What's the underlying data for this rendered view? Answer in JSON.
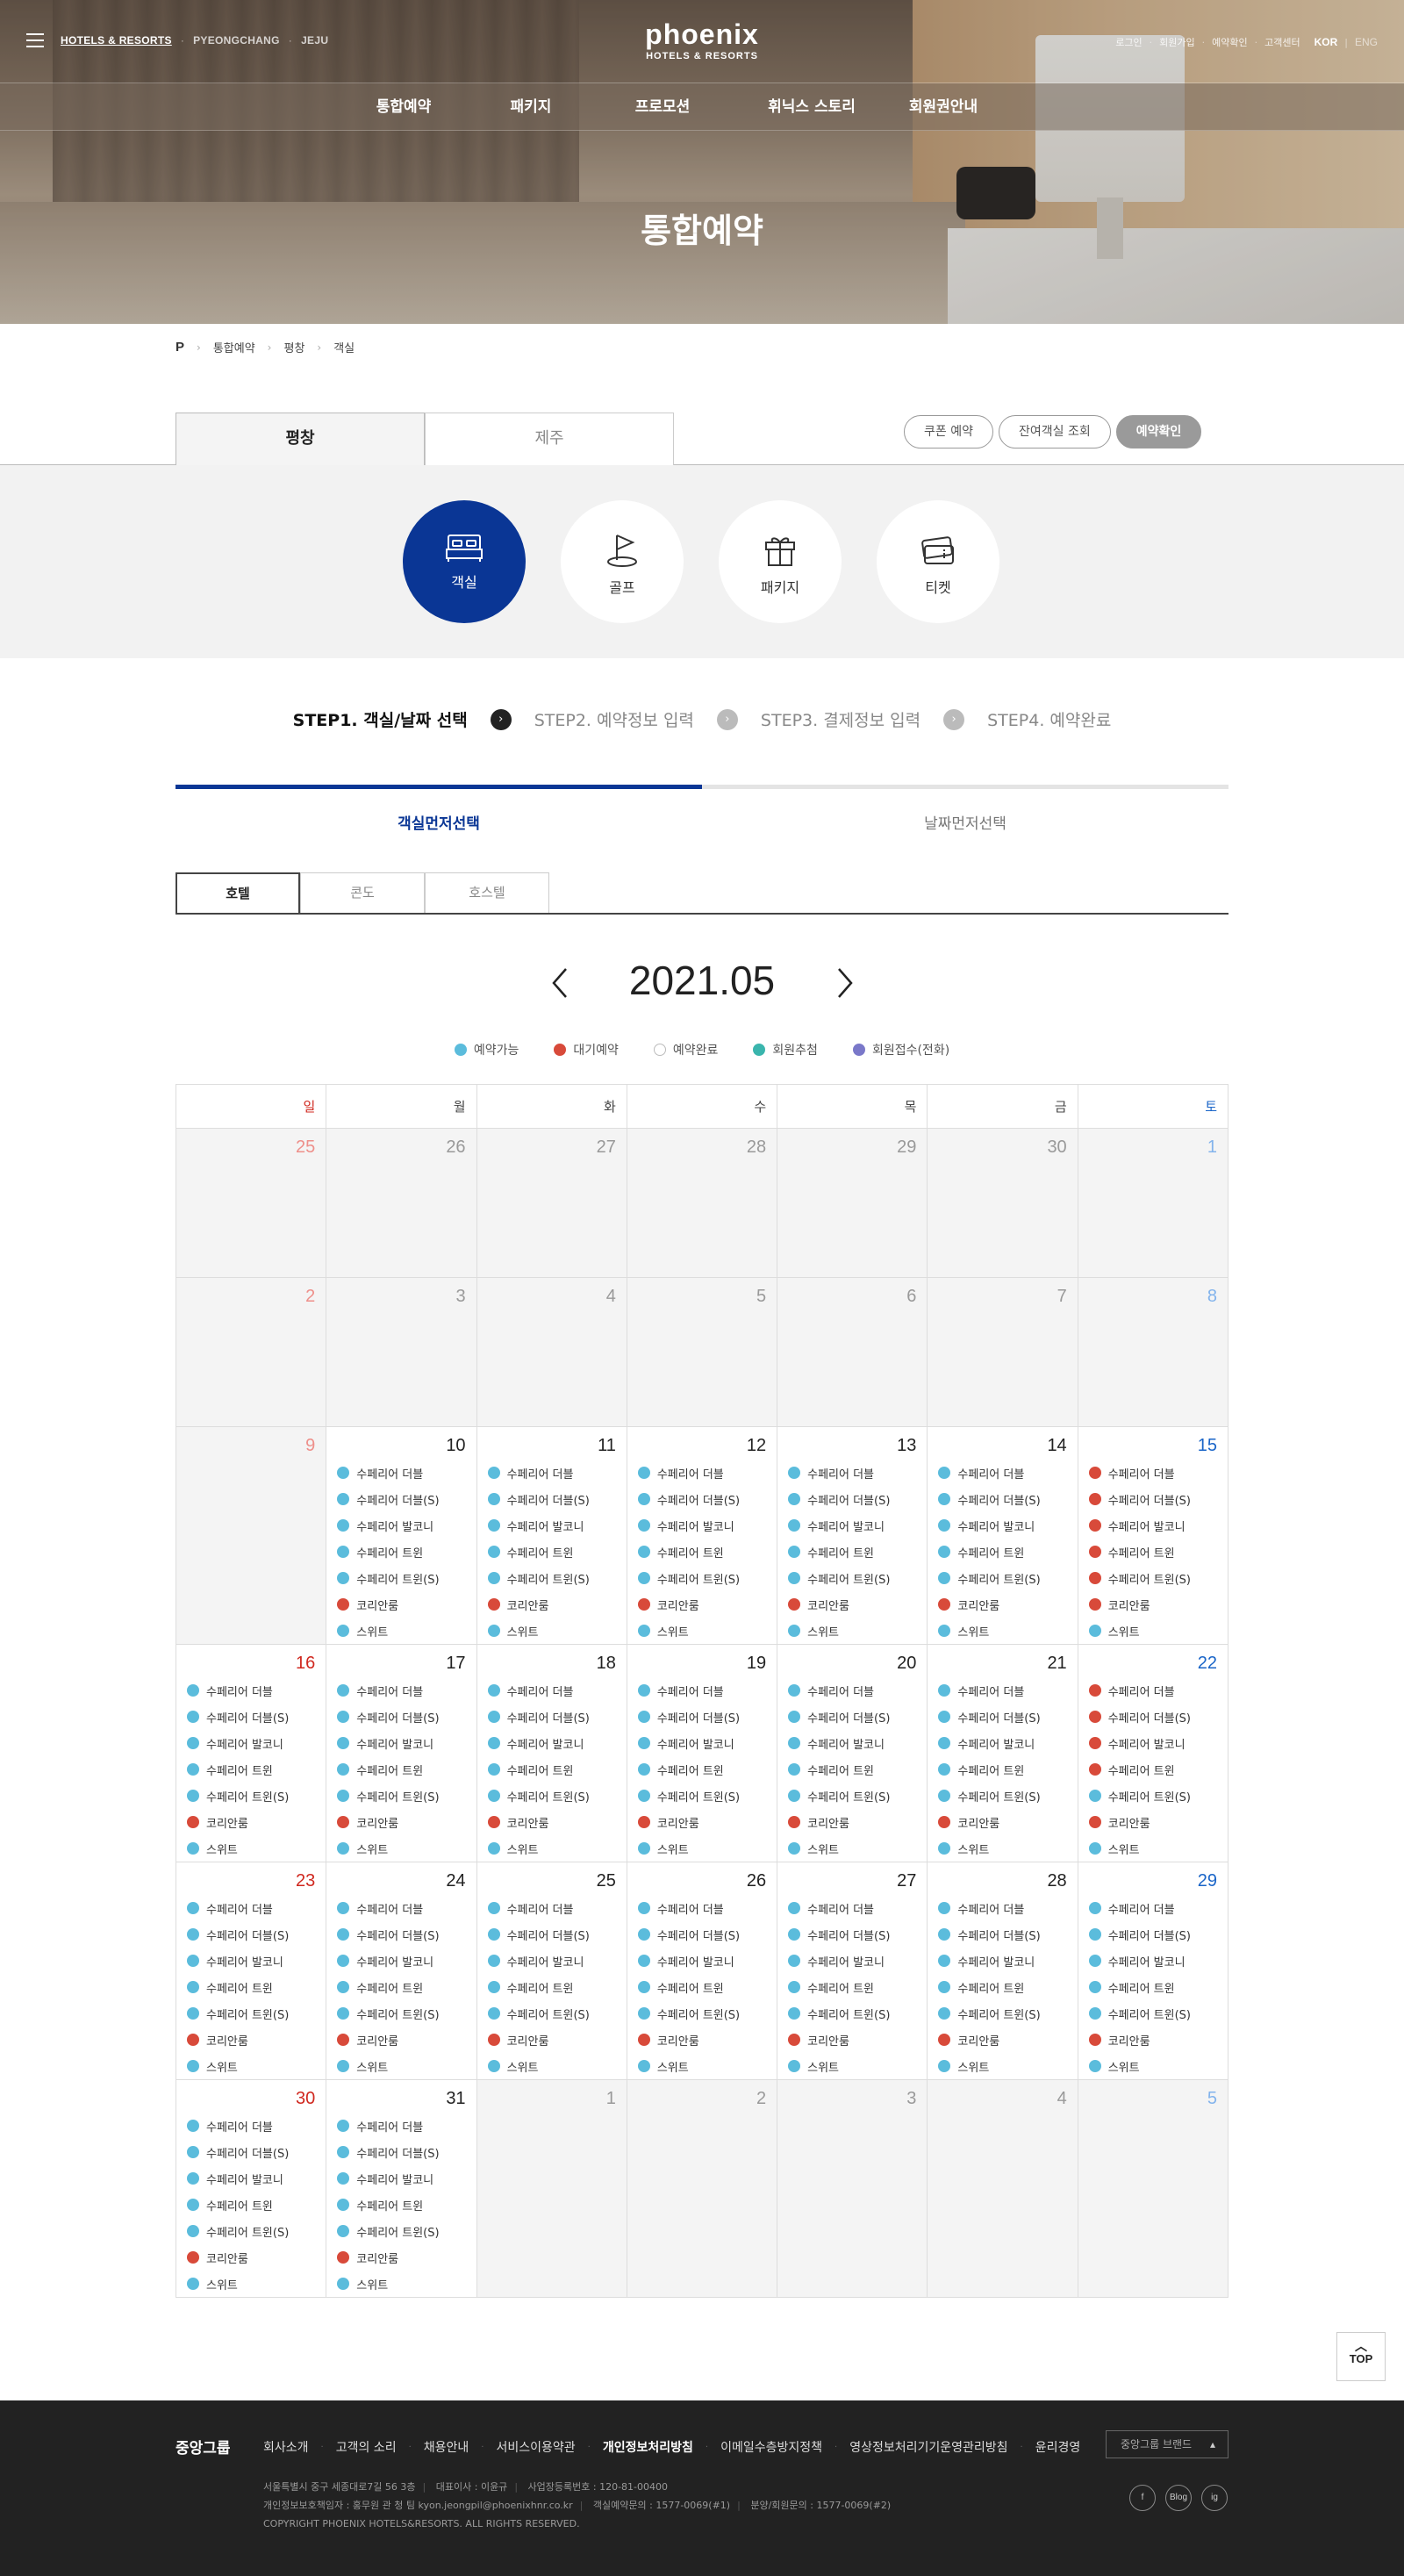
{
  "header": {
    "brand_links": [
      "HOTELS & RESORTS",
      "PYEONGCHANG",
      "JEJU"
    ],
    "logo_name": "phoenix",
    "logo_sub": "HOTELS & RESORTS",
    "util_links": [
      "로그인",
      "회원가입",
      "예약확인",
      "고객센터"
    ],
    "lang_active": "KOR",
    "lang_other": "ENG",
    "nav": [
      "통합예약",
      "패키지",
      "프로모션",
      "휘닉스 스토리",
      "회원권안내"
    ],
    "hero_title": "통합예약"
  },
  "breadcrumb": {
    "home": "P",
    "items": [
      "통합예약",
      "평창",
      "객실"
    ]
  },
  "region_tabs": [
    "평창",
    "제주"
  ],
  "action_buttons": [
    "쿠폰 예약",
    "잔여객실 조회",
    "예약확인"
  ],
  "categories": [
    "객실",
    "골프",
    "패키지",
    "티켓"
  ],
  "steps": [
    "STEP1. 객실/날짜 선택",
    "STEP2. 예약정보 입력",
    "STEP3. 결제정보 입력",
    "STEP4. 예약완료"
  ],
  "mode_tabs": [
    "객실먼저선택",
    "날짜먼저선택"
  ],
  "type_tabs": [
    "호텔",
    "콘도",
    "호스텔"
  ],
  "month": "2021.05",
  "legend": [
    {
      "label": "예약가능",
      "color": "#5bbcdc"
    },
    {
      "label": "대기예약",
      "color": "#d84a3a"
    },
    {
      "label": "예약완료",
      "color": "#ffffff"
    },
    {
      "label": "회원추첨",
      "color": "#3ab5ad"
    },
    {
      "label": "회원접수(전화)",
      "color": "#7a78c9"
    }
  ],
  "weekdays": [
    "일",
    "월",
    "화",
    "수",
    "목",
    "금",
    "토"
  ],
  "rooms": [
    "수페리어 더블",
    "수페리어 더블(S)",
    "수페리어 발코니",
    "수페리어 트윈",
    "수페리어 트윈(S)",
    "코리안룸",
    "스위트"
  ],
  "status_colors": {
    "a": "#5bbcdc",
    "w": "#d84a3a"
  },
  "calendar_weeks": [
    [
      {
        "d": "25",
        "off": true
      },
      {
        "d": "26",
        "off": true
      },
      {
        "d": "27",
        "off": true
      },
      {
        "d": "28",
        "off": true
      },
      {
        "d": "29",
        "off": true
      },
      {
        "d": "30",
        "off": true
      },
      {
        "d": "1",
        "off": true
      }
    ],
    [
      {
        "d": "2",
        "off": true
      },
      {
        "d": "3",
        "off": true
      },
      {
        "d": "4",
        "off": true
      },
      {
        "d": "5",
        "off": true
      },
      {
        "d": "6",
        "off": true
      },
      {
        "d": "7",
        "off": true
      },
      {
        "d": "8",
        "off": true
      }
    ],
    [
      {
        "d": "9",
        "off": true
      },
      {
        "d": "10",
        "s": "aaaaawa"
      },
      {
        "d": "11",
        "s": "aaaaawa"
      },
      {
        "d": "12",
        "s": "aaaaawa"
      },
      {
        "d": "13",
        "s": "aaaaawa"
      },
      {
        "d": "14",
        "s": "aaaaawa"
      },
      {
        "d": "15",
        "s": "wwwwwwa"
      }
    ],
    [
      {
        "d": "16",
        "s": "aaaaawa"
      },
      {
        "d": "17",
        "s": "aaaaawa"
      },
      {
        "d": "18",
        "s": "aaaaawa"
      },
      {
        "d": "19",
        "s": "aaaaawa"
      },
      {
        "d": "20",
        "s": "aaaaawa"
      },
      {
        "d": "21",
        "s": "aaaaawa"
      },
      {
        "d": "22",
        "s": "wwwwawa"
      }
    ],
    [
      {
        "d": "23",
        "s": "aaaaawa"
      },
      {
        "d": "24",
        "s": "aaaaawa"
      },
      {
        "d": "25",
        "s": "aaaaawa"
      },
      {
        "d": "26",
        "s": "aaaaawa"
      },
      {
        "d": "27",
        "s": "aaaaawa"
      },
      {
        "d": "28",
        "s": "aaaaawa"
      },
      {
        "d": "29",
        "s": "aaaaawa"
      }
    ],
    [
      {
        "d": "30",
        "s": "aaaaawa"
      },
      {
        "d": "31",
        "s": "aaaaawa"
      },
      {
        "d": "1",
        "off": true
      },
      {
        "d": "2",
        "off": true
      },
      {
        "d": "3",
        "off": true
      },
      {
        "d": "4",
        "off": true
      },
      {
        "d": "5",
        "off": true
      }
    ]
  ],
  "top_button": "TOP",
  "footer": {
    "group": "중앙그룹",
    "links": [
      "회사소개",
      "고객의 소리",
      "채용안내",
      "서비스이용약관",
      "개인정보처리방침",
      "이메일수층방지정책",
      "영상정보처리기기운영관리방침",
      "윤리경영"
    ],
    "select": "중앙그룹 브랜드",
    "info_line1": [
      "서울특별시 중구 세종대로7길 56 3층",
      "대표이사 : 이윤규",
      "사업장등록번호 : 120-81-00400"
    ],
    "info_line2": [
      "개인정보보호책임자 : 홍무원 관 청 팀 kyon.jeongpil@phoenixhnr.co.kr",
      "객실예약문의 : 1577-0069(#1)",
      "분양/회원문의 : 1577-0069(#2)"
    ],
    "copyright": "COPYRIGHT PHOENIX HOTELS&RESORTS. ALL RIGHTS RESERVED.",
    "socials": [
      "f",
      "Blog",
      "ig"
    ]
  }
}
